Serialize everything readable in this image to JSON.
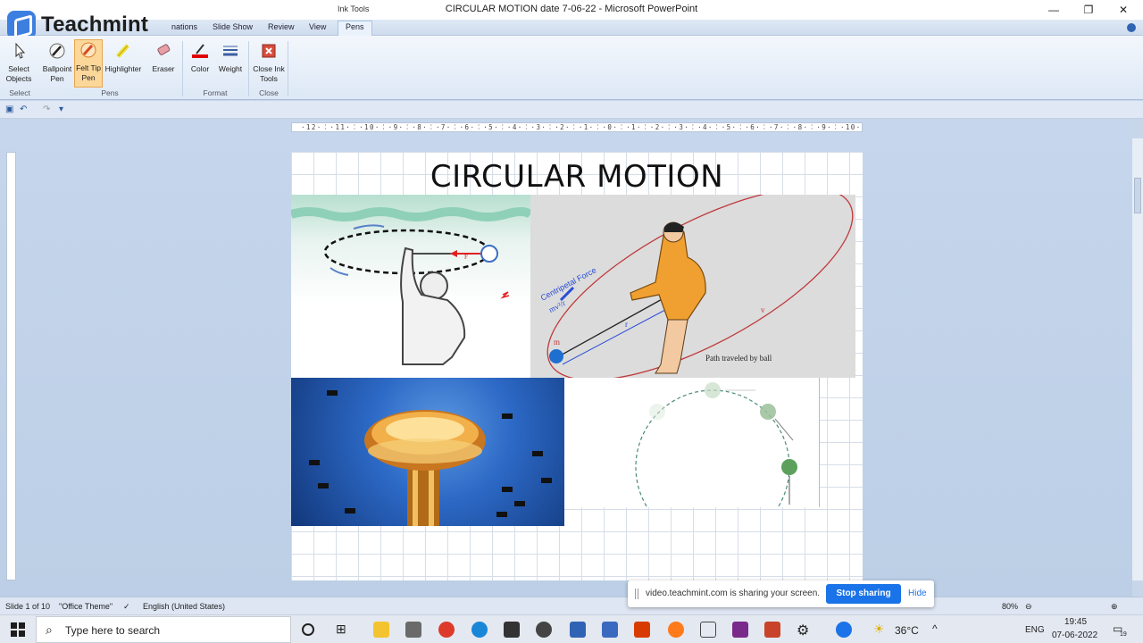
{
  "window": {
    "title": "CIRCULAR MOTION date 7-06-22  -  Microsoft PowerPoint",
    "context_tab_group": "Ink Tools",
    "controls": {
      "minimize": "—",
      "restore": "❐",
      "close": "✕"
    }
  },
  "branding": {
    "logo_text": "Teachmint"
  },
  "ribbon": {
    "tabs": [
      {
        "label": "nations"
      },
      {
        "label": "Slide Show"
      },
      {
        "label": "Review"
      },
      {
        "label": "View"
      },
      {
        "label": "Pens"
      }
    ],
    "active_tab": "Pens",
    "buttons": {
      "select_objects": "Select Objects",
      "ballpoint_pen": "Ballpoint Pen",
      "felt_tip_pen": "Felt Tip Pen",
      "highlighter": "Highlighter",
      "eraser": "Eraser",
      "color": "Color",
      "weight": "Weight",
      "close_ink_tools": "Close Ink Tools"
    },
    "groups": {
      "select": "Select",
      "pens": "Pens",
      "format": "Format",
      "close": "Close"
    },
    "colors": {
      "active_bg": "#fbd79a",
      "pen_color": "#e00000"
    }
  },
  "ruler": {
    "labels": "·12·︰·11·︰·10·︰·9·︰·8·︰·7·︰·6·︰·5·︰·4·︰·3·︰·2·︰·1·︰·0·︰·1·︰·2·︰·3·︰·4·︰·5·︰·6·︰·7·︰·8·︰·9·︰·10·︰·11·︰·12·"
  },
  "slide": {
    "title": "CIRCULAR MOTION",
    "image_labels": {
      "force": "F",
      "centripetal": "Centripetal Force",
      "formula": "mv²/r",
      "mass": "m",
      "radius": "r",
      "velocity": "v",
      "path": "Path traveled by ball"
    }
  },
  "status": {
    "slide": "Slide 1 of 10",
    "theme": "\"Office Theme\"",
    "language": "English (United States)",
    "zoom": "80%"
  },
  "sharing": {
    "message": "video.teachmint.com is sharing your screen.",
    "stop_label": "Stop sharing",
    "hide_label": "Hide"
  },
  "taskbar": {
    "search_placeholder": "Type here to search",
    "temperature": "36°C",
    "language": "ENG",
    "time": "19:45",
    "date": "07-06-2022",
    "notifications": "19"
  }
}
